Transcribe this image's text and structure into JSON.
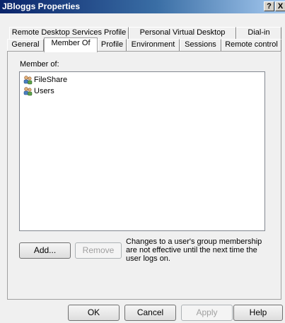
{
  "window": {
    "title": "JBloggs Properties",
    "help_label": "?",
    "close_label": "X"
  },
  "tabs_row1": [
    {
      "label": "Remote Desktop Services Profile"
    },
    {
      "label": "Personal Virtual Desktop"
    },
    {
      "label": "Dial-in"
    }
  ],
  "tabs_row2": [
    {
      "label": "General"
    },
    {
      "label": "Member Of"
    },
    {
      "label": "Profile"
    },
    {
      "label": "Environment"
    },
    {
      "label": "Sessions"
    },
    {
      "label": "Remote control"
    }
  ],
  "member_of": {
    "label": "Member of:",
    "groups": [
      {
        "name": "FileShare",
        "icon": "group-icon"
      },
      {
        "name": "Users",
        "icon": "group-icon"
      }
    ],
    "add_label": "Add...",
    "remove_label": "Remove",
    "note": "Changes to a user's group membership are not effective until the next time the user logs on."
  },
  "footer": {
    "ok_label": "OK",
    "cancel_label": "Cancel",
    "apply_label": "Apply",
    "help_label": "Help"
  }
}
